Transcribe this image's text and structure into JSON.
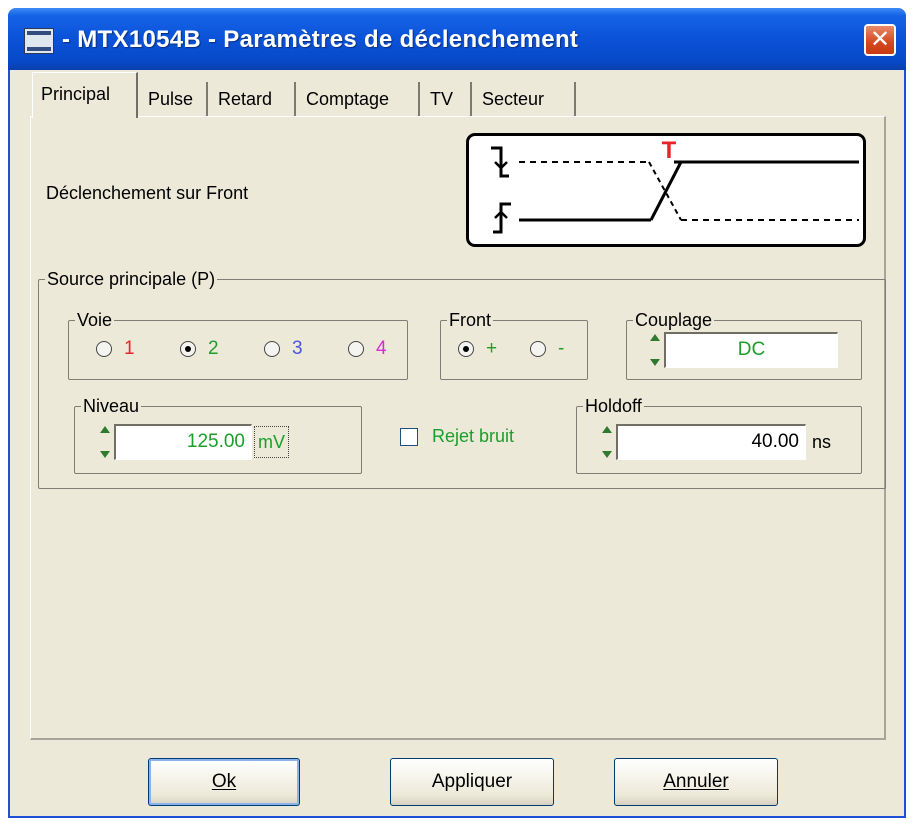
{
  "window": {
    "title": "- MTX1054B - Paramètres de déclenchement",
    "close_glyph": "✕"
  },
  "tabs": [
    {
      "label": "Principal",
      "active": true
    },
    {
      "label": "Pulse"
    },
    {
      "label": "Retard"
    },
    {
      "label": "Comptage"
    },
    {
      "label": "TV"
    },
    {
      "label": "Secteur"
    }
  ],
  "trigger_mode_label": "Déclenchement sur Front",
  "diagram": {
    "marker_label": "T"
  },
  "source": {
    "legend": "Source principale (P)",
    "voie": {
      "legend": "Voie",
      "options": [
        {
          "label": "1",
          "color": "#e8242a",
          "selected": false
        },
        {
          "label": "2",
          "color": "#1c9e2b",
          "selected": true
        },
        {
          "label": "3",
          "color": "#4a55e0",
          "selected": false
        },
        {
          "label": "4",
          "color": "#d82bd8",
          "selected": false
        }
      ]
    },
    "front": {
      "legend": "Front",
      "options": [
        {
          "label": "+",
          "color": "#1c9e2b",
          "selected": true
        },
        {
          "label": "-",
          "color": "#1c9e2b",
          "selected": false
        }
      ]
    },
    "couplage": {
      "legend": "Couplage",
      "value": "DC",
      "value_color": "#1c9e2b"
    },
    "niveau": {
      "legend": "Niveau",
      "value": "125.00",
      "unit": "mV",
      "value_color": "#1c9e2b"
    },
    "rejet_bruit": {
      "label": "Rejet bruit",
      "checked": false,
      "color": "#1c9e2b"
    },
    "holdoff": {
      "legend": "Holdoff",
      "value": "40.00",
      "unit": "ns"
    }
  },
  "buttons": {
    "ok": "Ok",
    "apply": "Appliquer",
    "cancel": "Annuler"
  },
  "icons": {
    "app": "oscilloscope-app-icon",
    "close": "close-icon",
    "spin": "spin-arrows-icon"
  }
}
